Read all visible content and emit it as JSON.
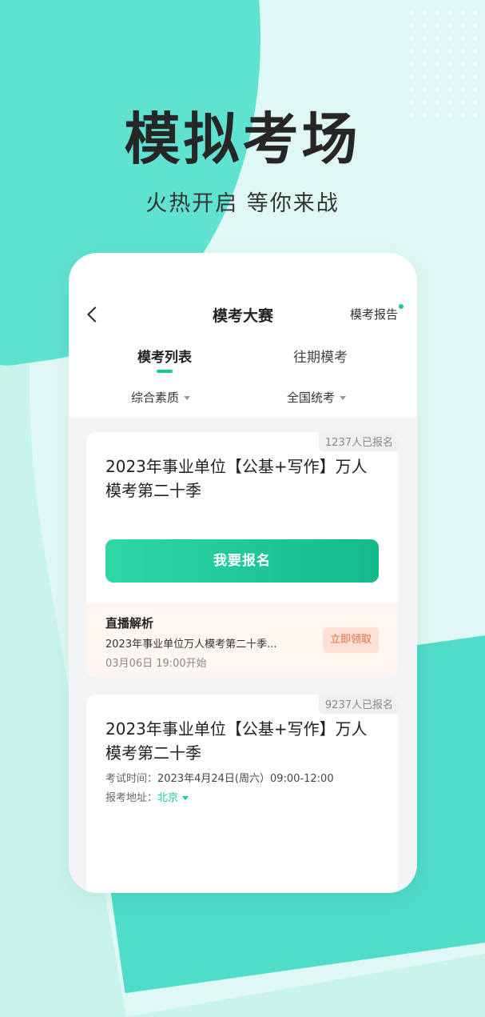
{
  "hero": {
    "title": "模拟考场",
    "subtitle": "火热开启  等你来战"
  },
  "nav": {
    "title": "模考大赛",
    "report": "模考报告"
  },
  "tabs": [
    {
      "label": "模考列表"
    },
    {
      "label": "往期模考"
    }
  ],
  "filters": [
    {
      "label": "综合素质"
    },
    {
      "label": "全国统考"
    }
  ],
  "cards": [
    {
      "badge": "1237人已报名",
      "title": "2023年事业单位【公基+写作】万人模考第二十季",
      "cta": "我要报名",
      "live": {
        "title": "直播解析",
        "desc": "2023年事业单位万人模考第二十季...",
        "time": "03月06日 19:00开始",
        "claim": "立即领取"
      }
    },
    {
      "badge": "9237人已报名",
      "title": "2023年事业单位【公基+写作】万人模考第二十季",
      "exam_time_label": "考试时间：",
      "exam_time": "2023年4月24日(周六）09:00-12:00",
      "location_label": "报考地址：",
      "location": "北京"
    }
  ],
  "colors": {
    "accent": "#19c7a3",
    "orange": "#f06b3c"
  }
}
